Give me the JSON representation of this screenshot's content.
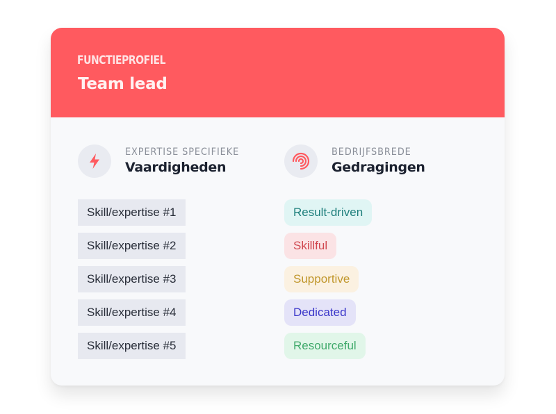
{
  "header": {
    "eyebrow": "FUNCTIEPROFIEL",
    "title": "Team lead",
    "color": "#ff5a5f"
  },
  "skills_column": {
    "icon": "lightning-bolt-icon",
    "subtitle": "EXPERTISE SPECIFIEKE",
    "title": "Vaardigheden",
    "items": [
      "Skill/expertise #1",
      "Skill/expertise #2",
      "Skill/expertise #3",
      "Skill/expertise #4",
      "Skill/expertise #5"
    ]
  },
  "behaviors_column": {
    "icon": "concentric-arcs-icon",
    "subtitle": "BEDRIJFSBREDE",
    "title": "Gedragingen",
    "items": [
      {
        "label": "Result-driven",
        "text_color": "#1e7f7c",
        "bg_color": "#e0f5f4"
      },
      {
        "label": "Skillful",
        "text_color": "#d0474f",
        "bg_color": "#fbe3e5"
      },
      {
        "label": "Supportive",
        "text_color": "#c0962a",
        "bg_color": "#fbf1e1"
      },
      {
        "label": "Dedicated",
        "text_color": "#3a36c9",
        "bg_color": "#e4e3f8"
      },
      {
        "label": "Resourceful",
        "text_color": "#3fa96a",
        "bg_color": "#e1f6e9"
      }
    ]
  }
}
